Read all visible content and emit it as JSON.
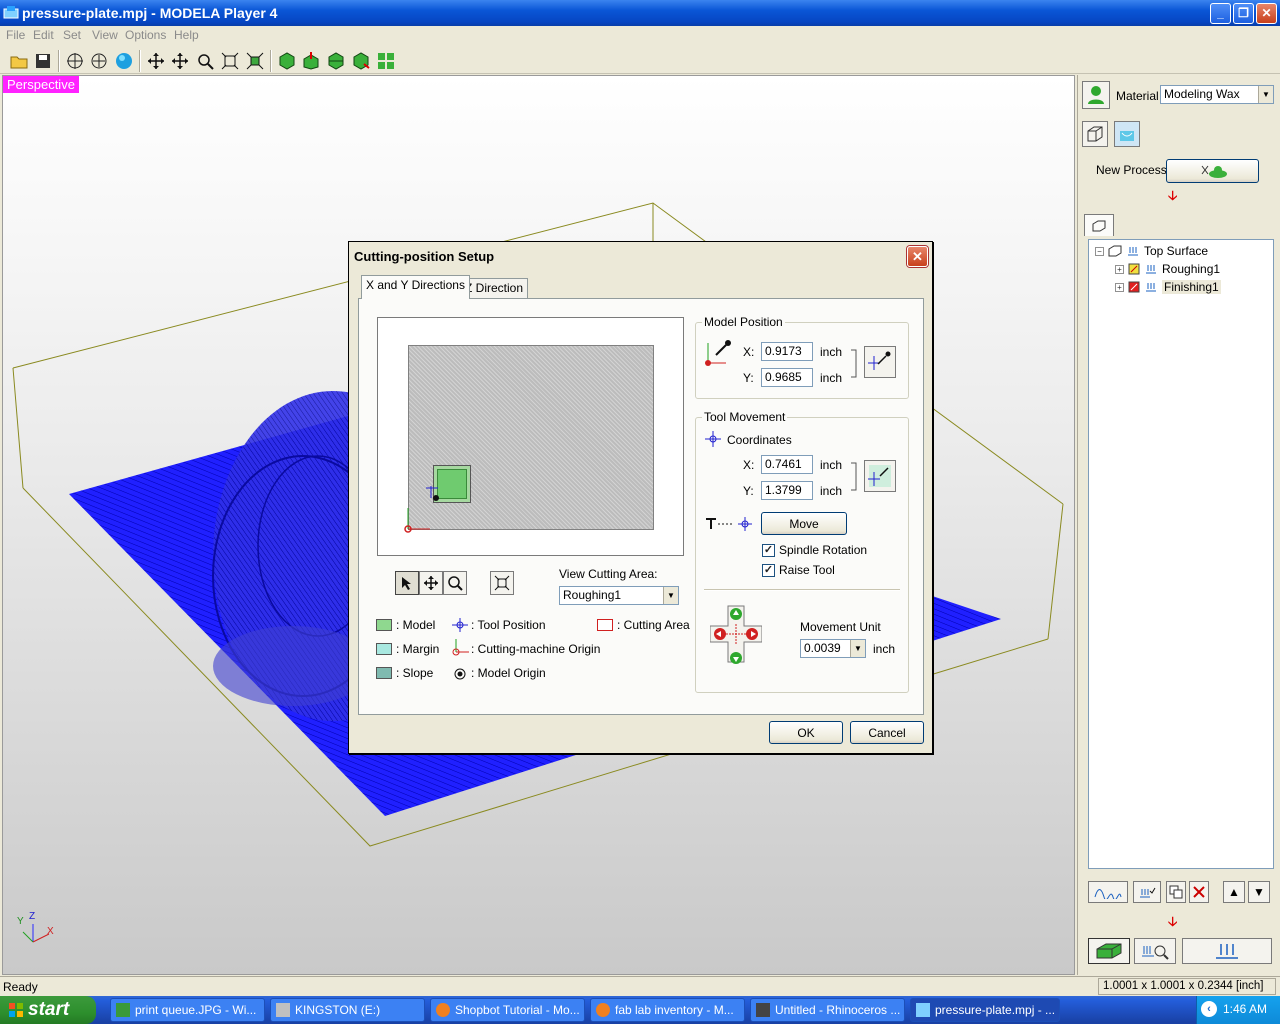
{
  "window": {
    "title": "pressure-plate.mpj - MODELA Player 4"
  },
  "menu": [
    "File",
    "Edit",
    "Set",
    "View",
    "Options",
    "Help"
  ],
  "viewport": {
    "label": "Perspective"
  },
  "panel": {
    "material_label": "Material",
    "material_value": "Modeling Wax",
    "new_process_label": "New Process",
    "tree": [
      "Top Surface",
      "Roughing1",
      "Finishing1"
    ]
  },
  "dialog": {
    "title": "Cutting-position Setup",
    "tabs": [
      "X and Y Directions",
      "Z Direction"
    ],
    "model_position": {
      "title": "Model Position",
      "x_label": "X:",
      "x_value": "0.9173",
      "y_label": "Y:",
      "y_value": "0.9685",
      "unit": "inch"
    },
    "tool_movement": {
      "title": "Tool Movement",
      "coordinates_label": "Coordinates",
      "x_label": "X:",
      "x_value": "0.7461",
      "y_label": "Y:",
      "y_value": "1.3799",
      "unit": "inch",
      "move_label": "Move",
      "spindle_label": "Spindle Rotation",
      "raise_label": "Raise Tool",
      "movement_unit_label": "Movement Unit",
      "movement_unit_value": "0.0039",
      "movement_unit_unit": "inch"
    },
    "view_cutting_area_label": "View Cutting Area:",
    "view_cutting_area_value": "Roughing1",
    "legend": {
      "model": ": Model",
      "margin": ": Margin",
      "slope": ": Slope",
      "tool_position": ": Tool Position",
      "machine_origin": ": Cutting-machine Origin",
      "model_origin": ": Model Origin",
      "cutting_area": ": Cutting Area"
    },
    "ok_label": "OK",
    "cancel_label": "Cancel"
  },
  "status": {
    "text": "Ready",
    "dimensions": "1.0001 x 1.0001 x 0.2344 [inch]"
  },
  "taskbar": {
    "start_label": "start",
    "tasks": [
      "print queue.JPG - Wi...",
      "KINGSTON (E:)",
      "Shopbot Tutorial - Mo...",
      "fab lab inventory - M...",
      "Untitled - Rhinoceros ...",
      "pressure-plate.mpj - ..."
    ],
    "clock": "1:46 AM"
  },
  "axes": {
    "x": "X",
    "y": "Y",
    "z": "Z"
  },
  "colors": {
    "mesh_blue": "#1010e0",
    "box_olive": "#8a8a20",
    "persp_bg": "#ff22ff",
    "model_green": "#6fcb6f"
  }
}
